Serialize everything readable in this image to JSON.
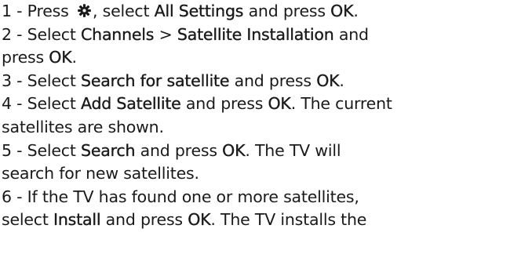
{
  "steps": [
    {
      "line1": {
        "t0": "1 -  Press ",
        "t1": ", select ",
        "b1": "All Settings",
        "t2": " and press  ",
        "b2": "OK",
        "t3": "."
      },
      "icon": "gear-icon"
    },
    {
      "line1": {
        "t0": "2 -  Select  ",
        "b1": "Channels",
        "t1": " >   ",
        "b2": "Satellite Installation",
        "t2": " and"
      },
      "line2": {
        "t0": "press  ",
        "b1": "OK",
        "t1": "."
      }
    },
    {
      "line1": {
        "t0": "3 -  Select  ",
        "b1": "Search for satellite",
        "t1": " and press   ",
        "b2": "OK",
        "t2": "."
      }
    },
    {
      "line1": {
        "t0": "4 -  Select  ",
        "b1": "Add Satellite",
        "t1": " and press   ",
        "b2": "OK",
        "t2": ". The current"
      },
      "line2": {
        "t0": "satellites are shown."
      }
    },
    {
      "line1": {
        "t0": "5 -  Select  ",
        "b1": "Search",
        "t1": "  and press  ",
        "b2": "OK",
        "t2": ". The TV will"
      },
      "line2": {
        "t0": "search for new satellites."
      }
    },
    {
      "line1": {
        "t0": "6 -  If the TV has found one or more satellites,"
      },
      "line2": {
        "t0": "select  ",
        "b1": "Install",
        "t1": " and press   ",
        "b2": "OK",
        "t2": ". The TV installs the"
      }
    }
  ],
  "colors": {
    "text": "#1a1a1a",
    "background": "#ffffff"
  }
}
